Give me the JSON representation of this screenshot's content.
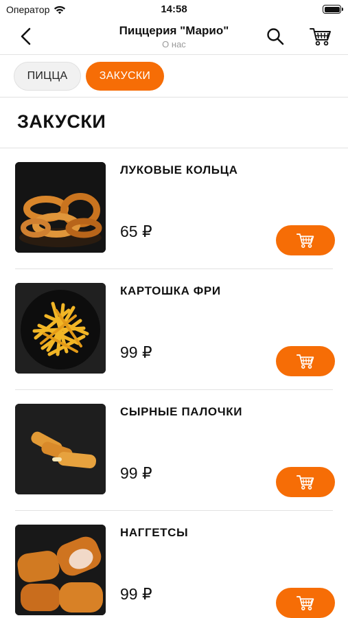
{
  "status_bar": {
    "carrier": "Оператор",
    "time": "14:58"
  },
  "navbar": {
    "title": "Пиццерия \"Марио\"",
    "subtitle": "О нас"
  },
  "tabs": [
    {
      "label": "ПИЦЦА",
      "active": false
    },
    {
      "label": "ЗАКУСКИ",
      "active": true
    }
  ],
  "section": {
    "title": "ЗАКУСКИ"
  },
  "products": [
    {
      "name": "ЛУКОВЫЕ КОЛЬЦА",
      "price": "65 ₽"
    },
    {
      "name": "КАРТОШКА ФРИ",
      "price": "99 ₽"
    },
    {
      "name": "СЫРНЫЕ ПАЛОЧКИ",
      "price": "99 ₽"
    },
    {
      "name": "НАГГЕТСЫ",
      "price": "99 ₽"
    }
  ],
  "colors": {
    "accent": "#f66d06",
    "divider": "#e2e2e2",
    "subtitle": "#9a9a9a"
  }
}
